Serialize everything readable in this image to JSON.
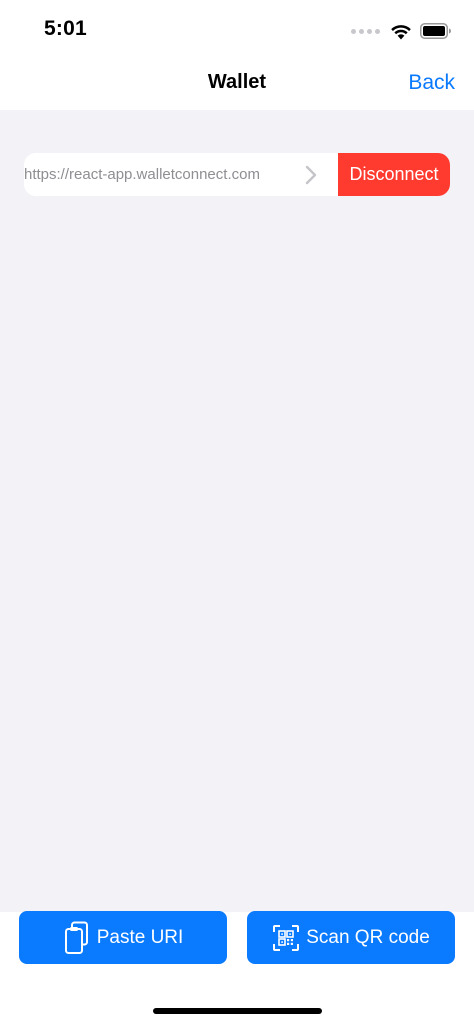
{
  "status_bar": {
    "time": "5:01",
    "icons": [
      "cellular-signal-icon",
      "wifi-icon",
      "battery-icon"
    ]
  },
  "nav": {
    "title": "Wallet",
    "back_label": "Back"
  },
  "sessions": [
    {
      "url": "https://react-app.walletconnect.com",
      "disconnect_label": "Disconnect"
    }
  ],
  "actions": {
    "paste_label": "Paste URI",
    "scan_label": "Scan QR code"
  },
  "colors": {
    "accent": "#0a7aff",
    "destructive": "#ff3b30",
    "background": "#f2f2f7",
    "secondary_text": "#8e8e93"
  }
}
